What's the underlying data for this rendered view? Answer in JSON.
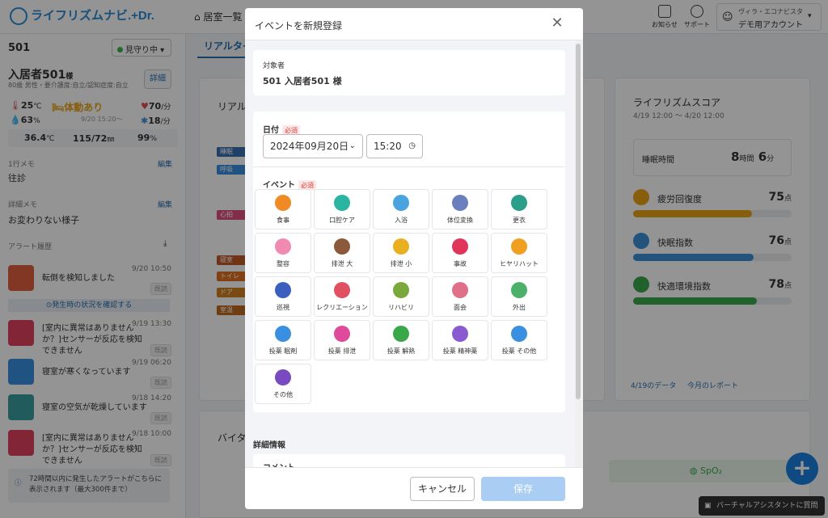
{
  "header": {
    "logo": "ライフリズムナビ.+Dr.",
    "nav_label": "居室一覧",
    "notice_label": "お知らせ",
    "support_label": "サポート",
    "facility": "ヴィラ・エコナビスタ",
    "account": "デモ用アカウント"
  },
  "left": {
    "room": "501",
    "watch_status": "見守り中",
    "resident_name": "入居者501",
    "resident_suffix": "様",
    "resident_info": "80歳 男性・要介護度:自立/認知症度:自立",
    "detail_button": "詳細",
    "room_temp": "25",
    "room_temp_unit": "℃",
    "room_humidity": "63",
    "room_humidity_unit": "%",
    "activity": "体動あり",
    "activity_time": "9/20 15:20〜",
    "heart_rate": "70",
    "heart_rate_unit": "/分",
    "resp_rate": "18",
    "resp_rate_unit": "/分",
    "body_temp": "36.4",
    "body_temp_unit": "℃",
    "blood_pressure": "115/72",
    "blood_pressure_unit": "㎜",
    "spo2": "99",
    "spo2_unit": "%",
    "memo1_label": "1行メモ",
    "memo1_edit": "編集",
    "memo1_value": "往診",
    "memo2_label": "詳細メモ",
    "memo2_edit": "編集",
    "memo2_value": "お変わりない様子",
    "alert_history_label": "アラート履歴",
    "alerts": [
      {
        "text": "転倒を検知しました",
        "time": "9/20 10:50",
        "badge": "既読"
      },
      {
        "text": "[室内に異常はありませんか？]センサーが反応を検知できません",
        "time": "9/19 13:30",
        "badge": "既読"
      },
      {
        "text": "寝室が寒くなっています",
        "time": "9/19 06:20",
        "badge": "既読"
      },
      {
        "text": "寝室の空気が乾燥しています",
        "time": "9/18 14:20",
        "badge": "既読"
      },
      {
        "text": "[室内に異常はありませんか？]センサーが反応を検知できません",
        "time": "9/18 10:00",
        "badge": "既読"
      }
    ],
    "confirm_link": "発生時の状況を確認する",
    "footer_note": "72時間以内に発生したアラートがこちらに表示されます（最大300件まで）"
  },
  "main": {
    "tab_label": "リアルタイム",
    "realtime_title": "リアルタイム",
    "chips": [
      "睡眠",
      "呼吸",
      "心拍",
      "寝室",
      "トイレ",
      "ドア",
      "室温"
    ],
    "vital_title": "バイタル",
    "spo2_label": "SpO₂"
  },
  "score": {
    "title": "ライフリズムスコア",
    "range": "4/19 12:00 〜 4/20 12:00",
    "sleep_label": "睡眠時間",
    "sleep_hours": "8",
    "sleep_h_unit": "時間",
    "sleep_minutes": "6",
    "sleep_m_unit": "分",
    "metrics": [
      {
        "label": "疲労回復度",
        "value": "75",
        "unit": "点",
        "pct": 75,
        "color": "#e8a316"
      },
      {
        "label": "快眠指数",
        "value": "76",
        "unit": "点",
        "pct": 76,
        "color": "#3a8fd8"
      },
      {
        "label": "快適環境指数",
        "value": "78",
        "unit": "点",
        "pct": 78,
        "color": "#3aa84a"
      }
    ],
    "link_data": "4/19のデータ",
    "link_report": "今月のレポート"
  },
  "modal": {
    "title": "イベントを新規登録",
    "target_label": "対象者",
    "target_value": "501 入居者501 様",
    "date_label": "日付",
    "required": "必須",
    "date_value": "2024年09月20日",
    "time_value": "15:20",
    "event_label": "イベント",
    "events": [
      {
        "label": "食事",
        "color": "#f08a24"
      },
      {
        "label": "口腔ケア",
        "color": "#2bb5a0"
      },
      {
        "label": "入浴",
        "color": "#4aa3df"
      },
      {
        "label": "体位変換",
        "color": "#6b7fbf"
      },
      {
        "label": "更衣",
        "color": "#2b9e8a"
      },
      {
        "label": "整容",
        "color": "#f08ab0"
      },
      {
        "label": "排泄 大",
        "color": "#8a5a3a"
      },
      {
        "label": "排泄 小",
        "color": "#e8b020"
      },
      {
        "label": "事故",
        "color": "#e0345a"
      },
      {
        "label": "ヒヤリハット",
        "color": "#f0a020"
      },
      {
        "label": "巡視",
        "color": "#3a5fbf"
      },
      {
        "label": "レクリエーション",
        "color": "#e05060"
      },
      {
        "label": "リハビリ",
        "color": "#7aa83a"
      },
      {
        "label": "面会",
        "color": "#e0708a"
      },
      {
        "label": "外出",
        "color": "#4ab06a"
      },
      {
        "label": "投薬 眠剤",
        "color": "#3a8fe0"
      },
      {
        "label": "投薬 排泄",
        "color": "#e04a9a"
      },
      {
        "label": "投薬 解熱",
        "color": "#3aa84a"
      },
      {
        "label": "投薬 精神薬",
        "color": "#8a5ad0"
      },
      {
        "label": "投薬 その他",
        "color": "#3a8fe0"
      },
      {
        "label": "その他",
        "color": "#7a4ac0"
      }
    ],
    "detail_section": "詳細情報",
    "comment_label": "コメント",
    "cancel_label": "キャンセル",
    "save_label": "保存"
  },
  "assistant_label": "バーチャルアシスタントに質問"
}
